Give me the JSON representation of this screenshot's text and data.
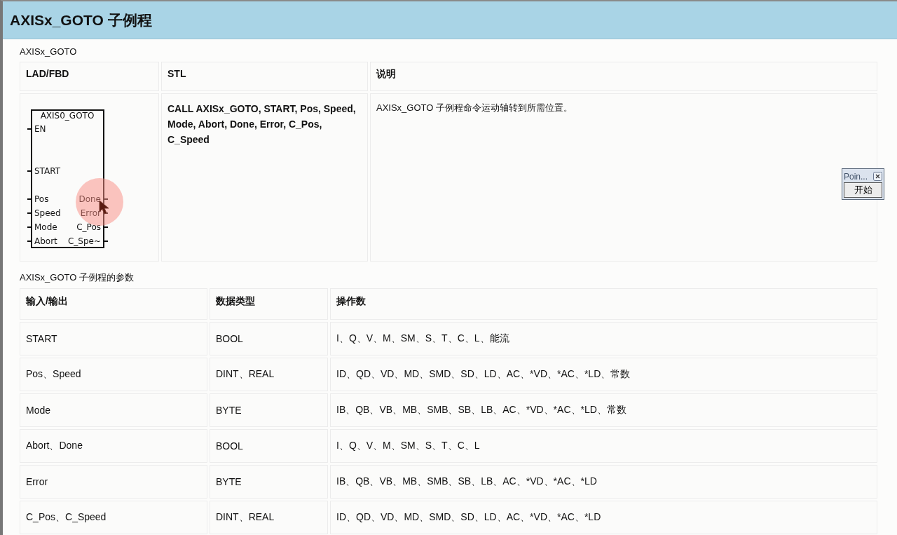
{
  "header": {
    "title": "AXISx_GOTO 子例程"
  },
  "summary": {
    "caption": "AXISx_GOTO",
    "columns": [
      "LAD/FBD",
      "STL",
      "说明"
    ],
    "block": {
      "title": "AXIS0_GOTO",
      "inputs": [
        "EN",
        "START",
        "Pos",
        "Speed",
        "Mode",
        "Abort"
      ],
      "outputs": [
        "Done",
        "Error",
        "C_Pos",
        "C_Spe~"
      ]
    },
    "stl": "CALL AXISx_GOTO, START, Pos, Speed, Mode, Abort, Done, Error, C_Pos, C_Speed",
    "description": "AXISx_GOTO 子例程命令运动轴转到所需位置。"
  },
  "params": {
    "caption": "AXISx_GOTO 子例程的参数",
    "columns": [
      "输入/输出",
      "数据类型",
      "操作数"
    ],
    "rows": [
      [
        "START",
        "BOOL",
        "I、Q、V、M、SM、S、T、C、L、能流"
      ],
      [
        "Pos、Speed",
        "DINT、REAL",
        "ID、QD、VD、MD、SMD、SD、LD、AC、*VD、*AC、*LD、常数"
      ],
      [
        "Mode",
        "BYTE",
        "IB、QB、VB、MB、SMB、SB、LB、AC、*VD、*AC、*LD、常数"
      ],
      [
        "Abort、Done",
        "BOOL",
        "I、Q、V、M、SM、S、T、C、L"
      ],
      [
        "Error",
        "BYTE",
        "IB、QB、VB、MB、SMB、SB、LB、AC、*VD、*AC、*LD"
      ],
      [
        "C_Pos、C_Speed",
        "DINT、REAL",
        "ID、QD、VD、MD、SMD、SD、LD、AC、*VD、*AC、*LD"
      ]
    ]
  },
  "popup": {
    "title": "Poin...",
    "button": "开始"
  }
}
